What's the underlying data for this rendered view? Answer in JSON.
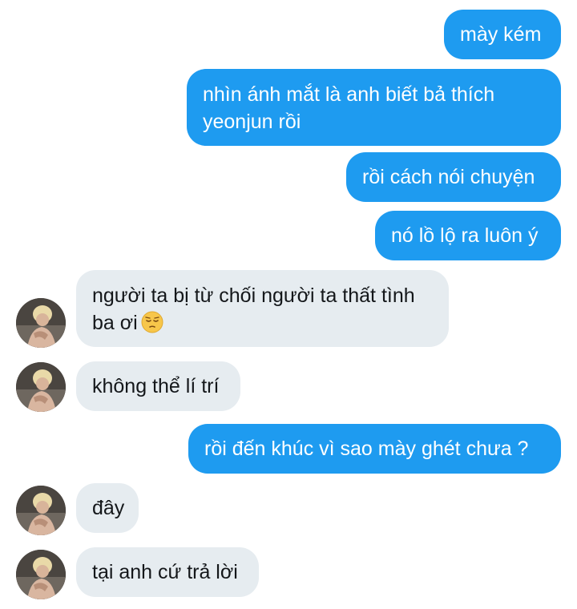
{
  "conversation": {
    "sent": [
      {
        "text": "mày kém"
      },
      {
        "text": "nhìn ánh mắt là anh biết bả thích yeonjun rồi"
      },
      {
        "text": "rồi cách nói chuyện"
      },
      {
        "text": "nó lồ lộ ra luôn ý"
      },
      {
        "text": "rồi đến khúc vì sao mày ghét chưa ?"
      }
    ],
    "received": [
      {
        "text": "người ta bị từ chối người ta thất tình ba ơi",
        "emoji": "pensive-face"
      },
      {
        "text": "không thể lí trí"
      },
      {
        "text": "đây"
      },
      {
        "text": "tại anh cứ trả lời"
      }
    ],
    "avatar_icon": "user-avatar-photo"
  },
  "colors": {
    "sent_bubble": "#1e9bf0",
    "sent_text": "#ffffff",
    "received_bubble": "#e6ecf0",
    "received_text": "#14171a",
    "background": "#ffffff"
  }
}
